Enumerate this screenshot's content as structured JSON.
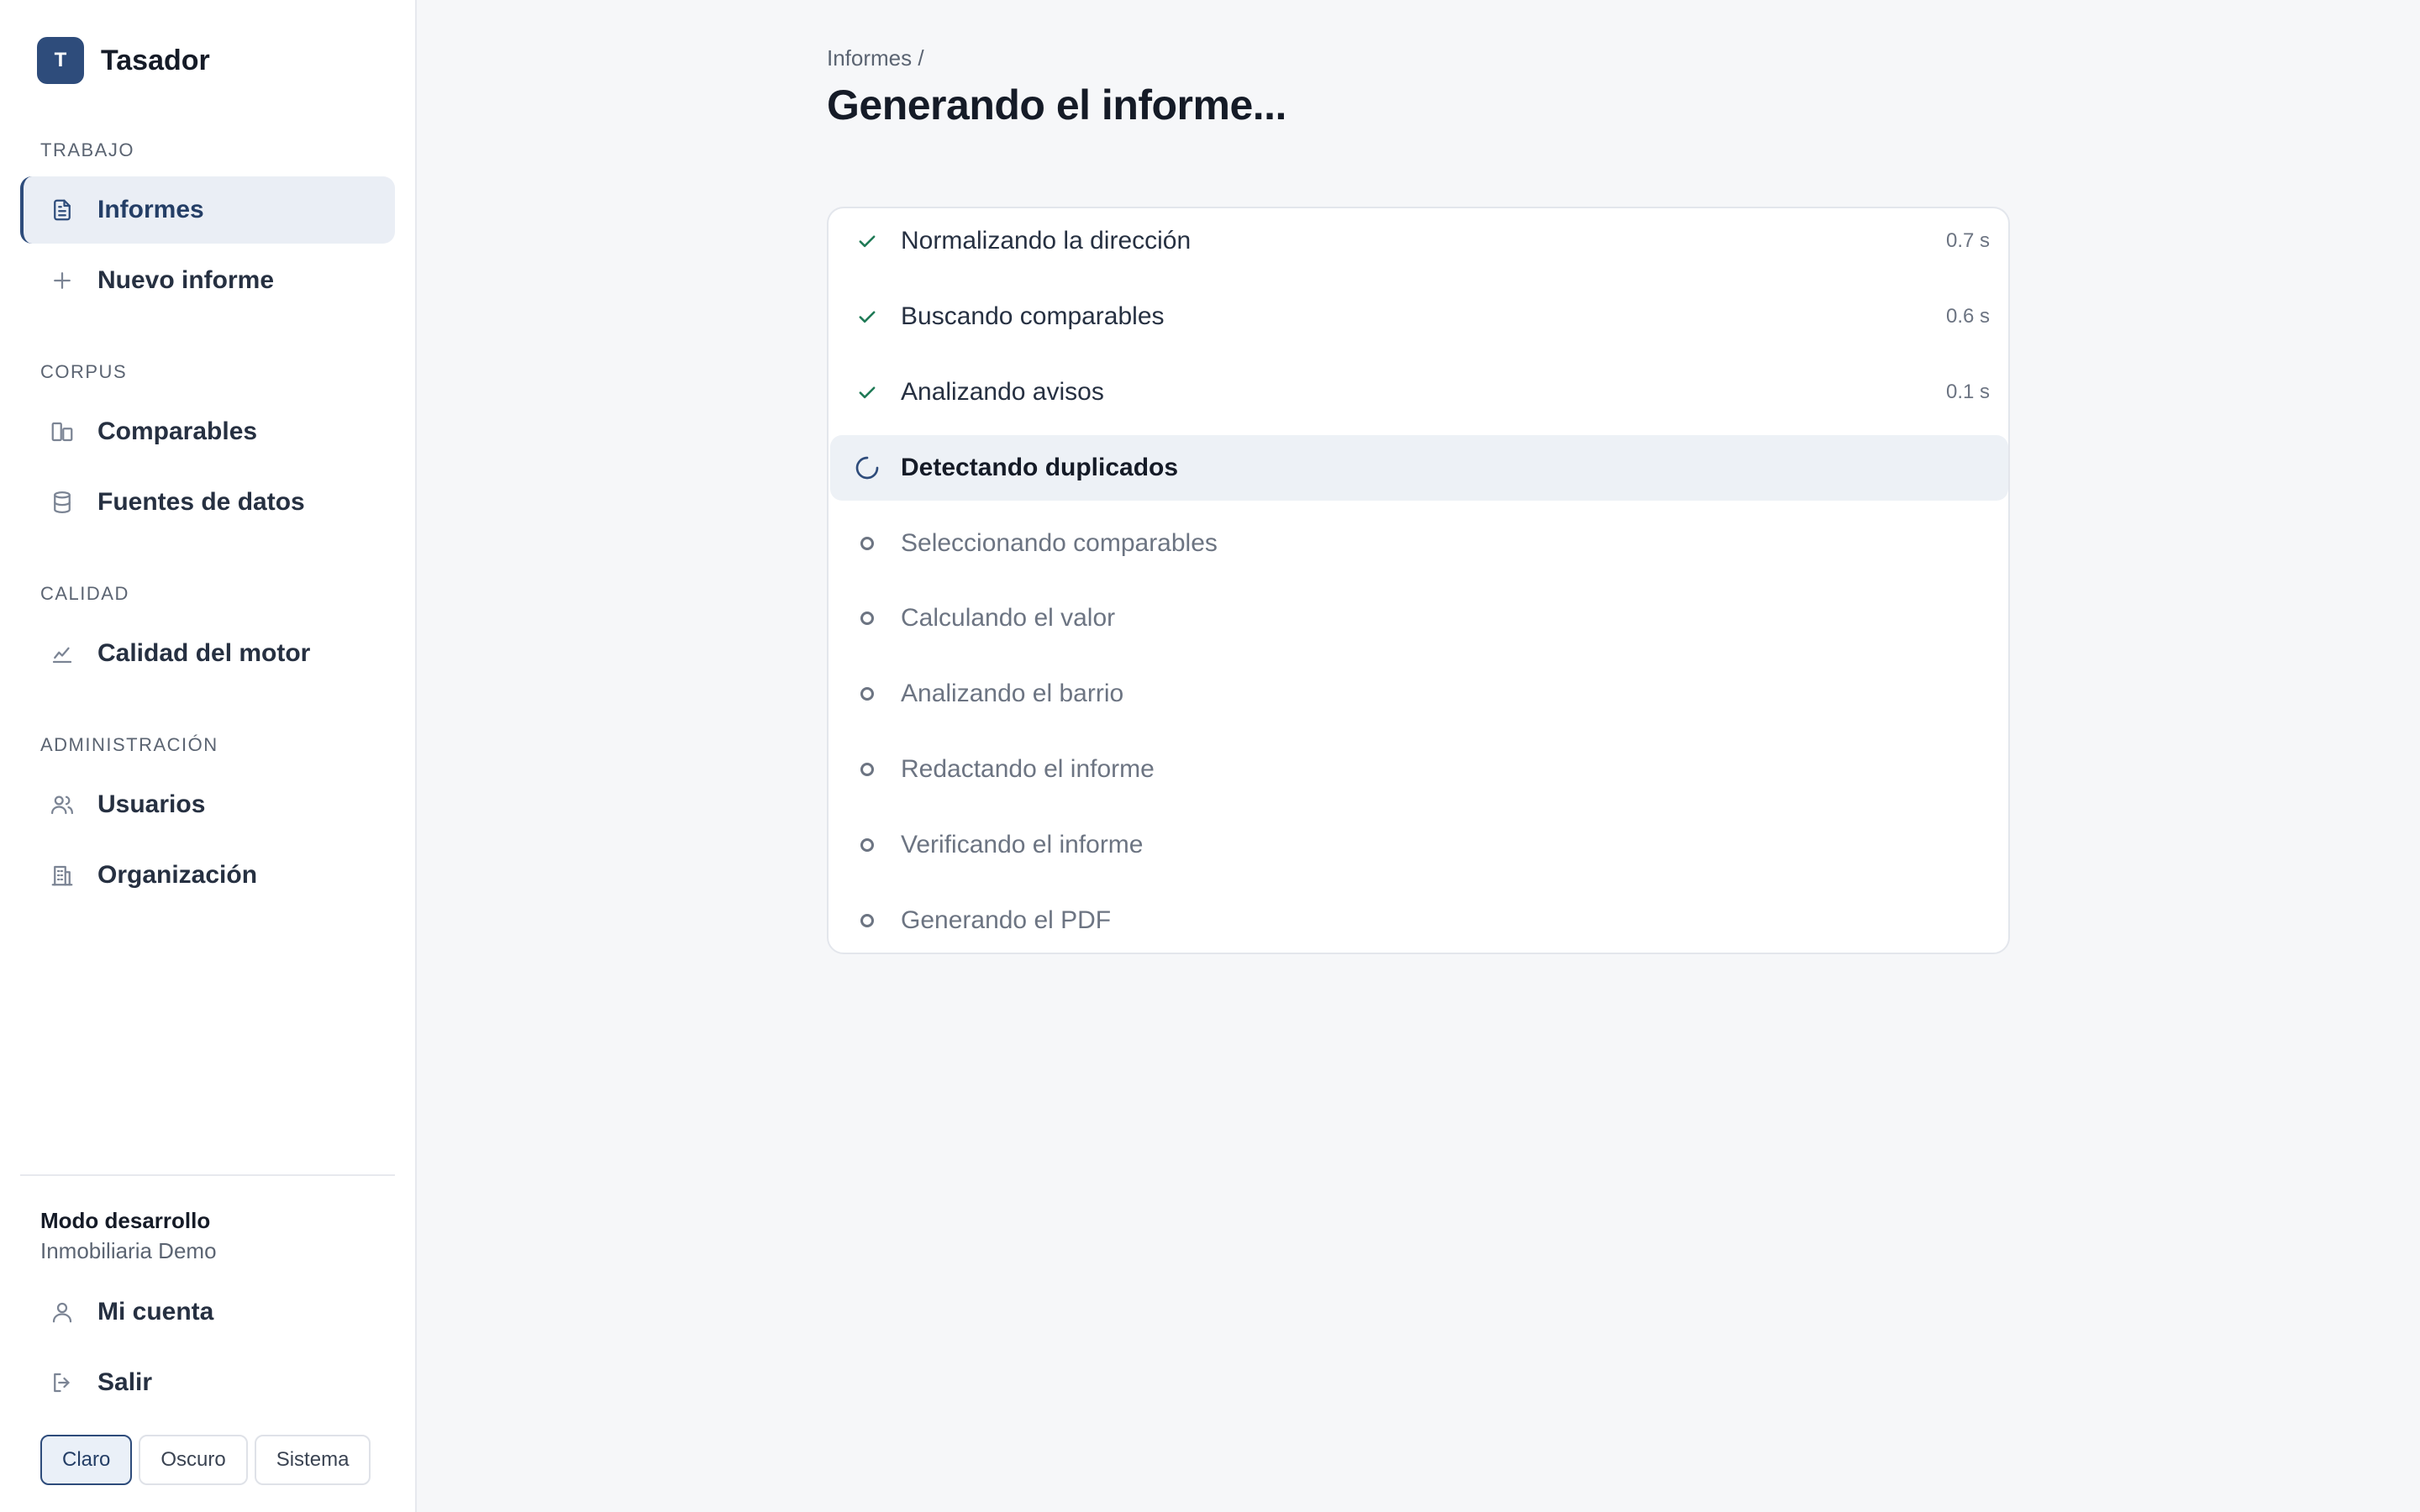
{
  "brand": {
    "logo_letter": "T",
    "name": "Tasador"
  },
  "sidebar": {
    "sections": [
      {
        "label": "TRABAJO",
        "items": [
          {
            "label": "Informes",
            "icon": "document-icon",
            "active": true
          },
          {
            "label": "Nuevo informe",
            "icon": "plus-icon",
            "active": false
          }
        ]
      },
      {
        "label": "CORPUS",
        "items": [
          {
            "label": "Comparables",
            "icon": "buildings-icon",
            "active": false
          },
          {
            "label": "Fuentes de datos",
            "icon": "database-icon",
            "active": false
          }
        ]
      },
      {
        "label": "CALIDAD",
        "items": [
          {
            "label": "Calidad del motor",
            "icon": "line-chart-icon",
            "active": false
          }
        ]
      },
      {
        "label": "ADMINISTRACIÓN",
        "items": [
          {
            "label": "Usuarios",
            "icon": "users-icon",
            "active": false
          },
          {
            "label": "Organización",
            "icon": "building-icon",
            "active": false
          }
        ]
      }
    ],
    "mode": {
      "title": "Modo desarrollo",
      "org": "Inmobiliaria Demo"
    },
    "account": {
      "label": "Mi cuenta",
      "icon": "user-icon"
    },
    "logout": {
      "label": "Salir",
      "icon": "logout-icon"
    },
    "themes": [
      {
        "label": "Claro",
        "active": true
      },
      {
        "label": "Oscuro",
        "active": false
      },
      {
        "label": "Sistema",
        "active": false
      }
    ]
  },
  "main": {
    "breadcrumb": "Informes /",
    "title": "Generando el informe...",
    "steps": [
      {
        "label": "Normalizando la dirección",
        "status": "done",
        "time": "0.7 s"
      },
      {
        "label": "Buscando comparables",
        "status": "done",
        "time": "0.6 s"
      },
      {
        "label": "Analizando avisos",
        "status": "done",
        "time": "0.1 s"
      },
      {
        "label": "Detectando duplicados",
        "status": "running",
        "time": ""
      },
      {
        "label": "Seleccionando comparables",
        "status": "pending",
        "time": ""
      },
      {
        "label": "Calculando el valor",
        "status": "pending",
        "time": ""
      },
      {
        "label": "Analizando el barrio",
        "status": "pending",
        "time": ""
      },
      {
        "label": "Redactando el informe",
        "status": "pending",
        "time": ""
      },
      {
        "label": "Verificando el informe",
        "status": "pending",
        "time": ""
      },
      {
        "label": "Generando el PDF",
        "status": "pending",
        "time": ""
      }
    ]
  },
  "colors": {
    "accent": "#2e4c7b",
    "check": "#1f7a56",
    "muted": "#6c7482",
    "background": "#f6f7f9"
  }
}
